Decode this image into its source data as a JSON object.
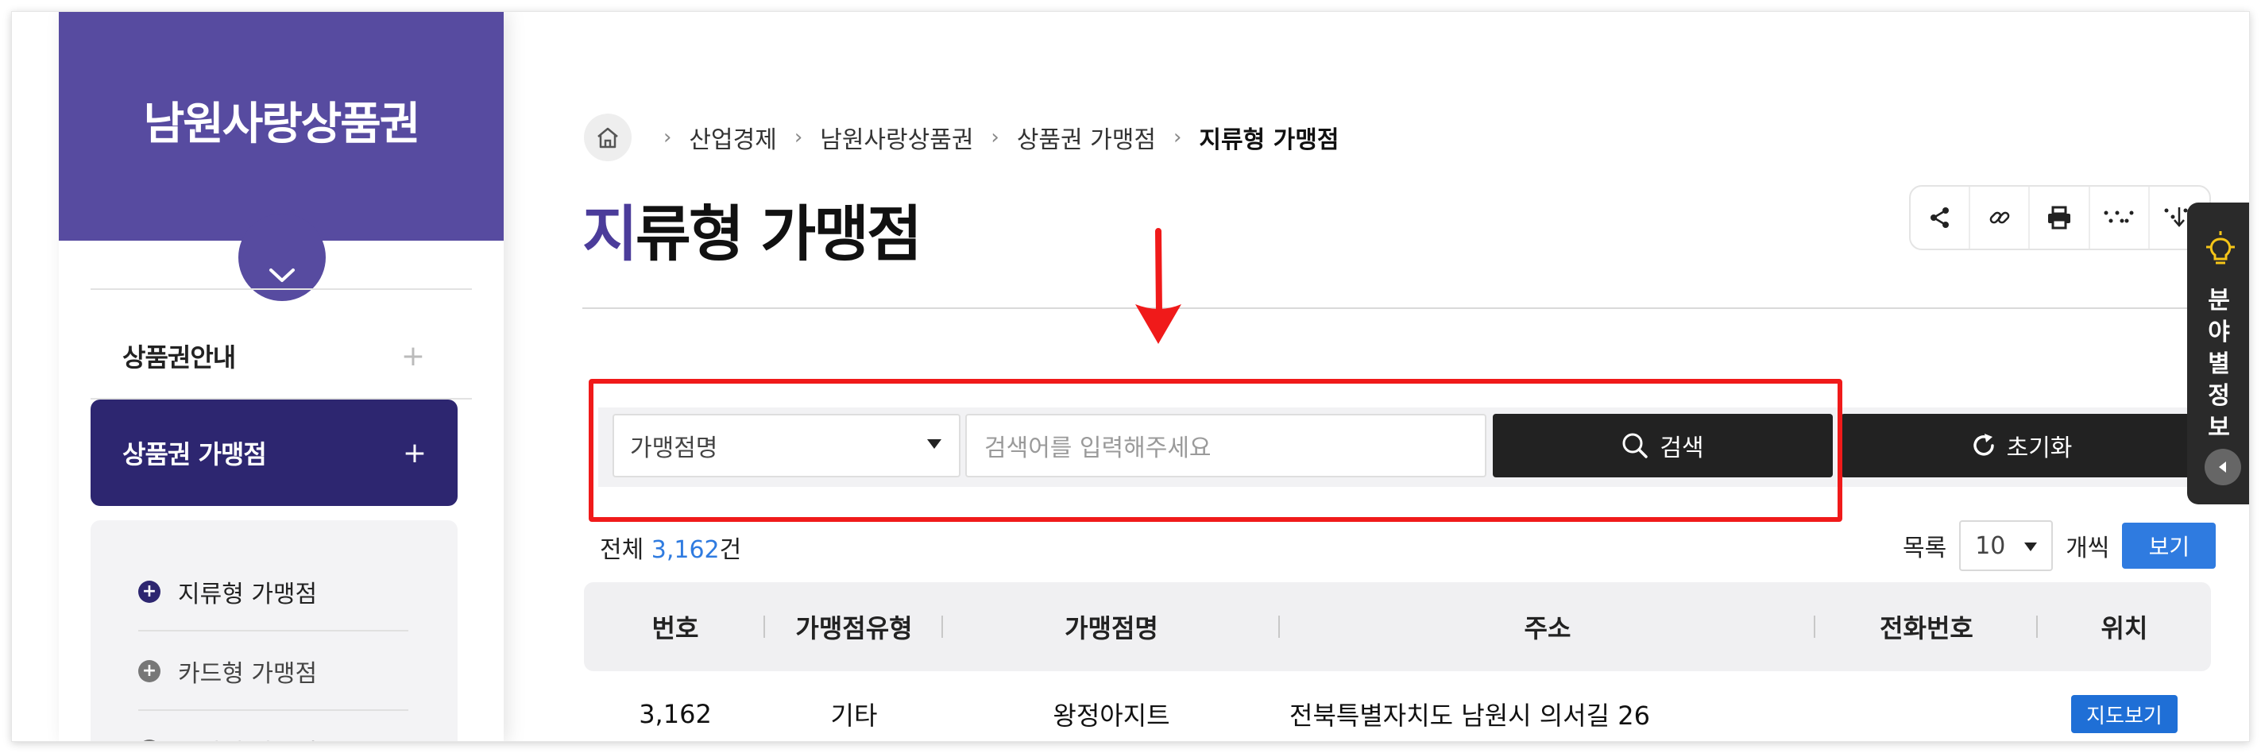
{
  "sidebar": {
    "title": "남원사랑상품권",
    "menu": [
      {
        "label": "상품권안내",
        "icon": "plus-icon"
      },
      {
        "label": "상품권 가맹점",
        "icon": "plus-icon"
      }
    ],
    "submenu": [
      {
        "label": "지류형 가맹점"
      },
      {
        "label": "카드형 가맹점"
      },
      {
        "label": "모바일 가맹점"
      }
    ]
  },
  "breadcrumb": {
    "items": [
      "산업경제",
      "남원사랑상품권",
      "상품권 가맹점",
      "지류형 가맹점"
    ],
    "separator": "›"
  },
  "page": {
    "title_first": "지",
    "title_rest": "류형 가맹점"
  },
  "search": {
    "field_select": "가맹점명",
    "placeholder": "검색어를 입력해주세요",
    "search_label": "검색",
    "reset_label": "초기화"
  },
  "list": {
    "total_prefix": "전체",
    "total_count": "3,162",
    "total_suffix": "건",
    "per_page_label": "목록",
    "per_page_value": "10",
    "per_page_unit": "개씩",
    "view_label": "보기"
  },
  "table": {
    "headers": [
      "번호",
      "가맹점유형",
      "가맹점명",
      "주소",
      "전화번호",
      "위치"
    ],
    "rows": [
      {
        "no": "3,162",
        "type": "기타",
        "name": "왕정아지트",
        "address": "전북특별자치도 남원시 의서길 26",
        "phone": "",
        "map_label": "지도보기"
      }
    ]
  },
  "side_panel": {
    "text": "분야별정보"
  },
  "colors": {
    "sidebar": "#574ba0",
    "active_menu": "#2d2670",
    "accent_blue": "#2f7be0",
    "highlight_red": "#f01a1a"
  }
}
